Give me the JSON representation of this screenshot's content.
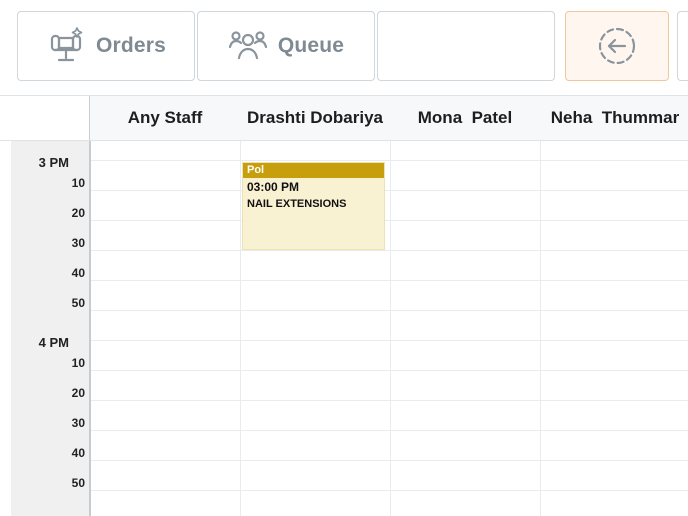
{
  "toolbar": {
    "orders_label": "Orders",
    "queue_label": "Queue",
    "orders_icon": "salon-chair-icon",
    "queue_icon": "people-queue-icon",
    "back_icon": "circle-arrow-left-icon"
  },
  "calendar": {
    "staff": [
      "Any Staff",
      "Drashti Dobariya",
      "Mona  Patel",
      "Neha  Thummar"
    ],
    "time_labels": [
      "3 PM",
      "10",
      "20",
      "30",
      "40",
      "50",
      "4 PM",
      "10",
      "20",
      "30",
      "40",
      "50"
    ]
  },
  "appointment": {
    "client": "Pol",
    "time": "03:00 PM",
    "service": "NAIL EXTENSIONS",
    "bar_color": "#c79f0d",
    "bg_color": "#f8f1d2"
  }
}
